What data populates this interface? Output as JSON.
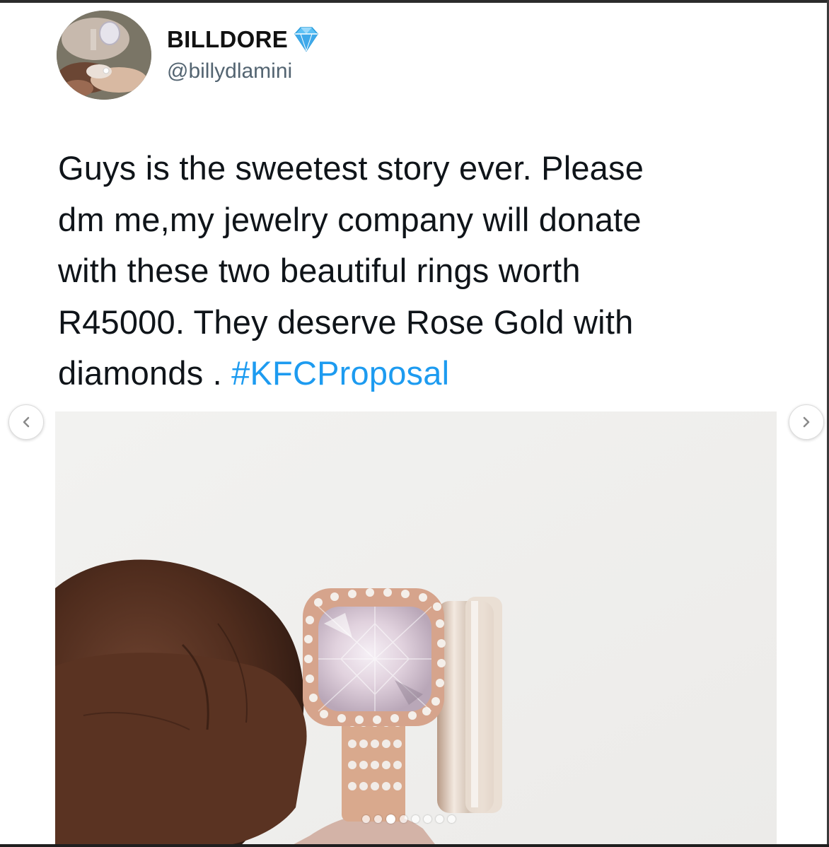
{
  "tweet": {
    "display_name": "BILLDORE",
    "handle": "@billydlamini",
    "verified_icon": "diamond-icon",
    "text_lines": [
      "Guys is the sweetest story ever. Please",
      "dm me,my jewelry company will donate",
      "with these two beautiful rings worth",
      "R45000. They deserve Rose Gold with"
    ],
    "text_last_line": "diamonds . ",
    "hashtag": "#KFCProposal",
    "hashtag_color": "#1d9bf0"
  },
  "media": {
    "image": "rings-on-finger-photo",
    "carousel_count": 8,
    "carousel_active_index": 2
  },
  "navigation": {
    "prev_icon": "chevron-left-icon",
    "next_icon": "chevron-right-icon"
  }
}
